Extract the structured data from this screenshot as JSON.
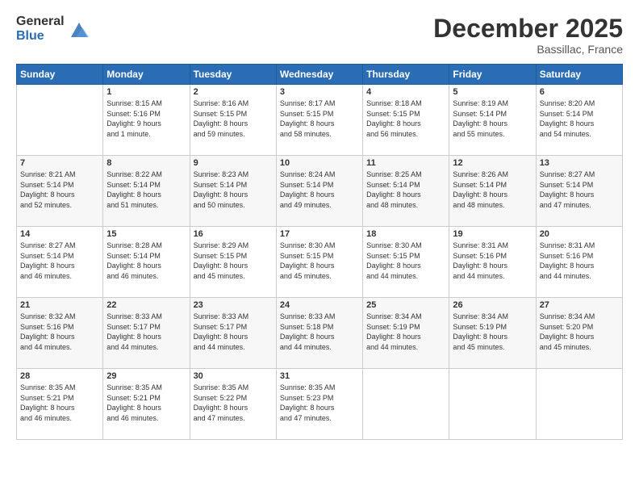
{
  "logo": {
    "general": "General",
    "blue": "Blue"
  },
  "header": {
    "month": "December 2025",
    "location": "Bassillac, France"
  },
  "weekdays": [
    "Sunday",
    "Monday",
    "Tuesday",
    "Wednesday",
    "Thursday",
    "Friday",
    "Saturday"
  ],
  "weeks": [
    [
      {
        "day": "",
        "info": ""
      },
      {
        "day": "1",
        "info": "Sunrise: 8:15 AM\nSunset: 5:16 PM\nDaylight: 9 hours\nand 1 minute."
      },
      {
        "day": "2",
        "info": "Sunrise: 8:16 AM\nSunset: 5:15 PM\nDaylight: 8 hours\nand 59 minutes."
      },
      {
        "day": "3",
        "info": "Sunrise: 8:17 AM\nSunset: 5:15 PM\nDaylight: 8 hours\nand 58 minutes."
      },
      {
        "day": "4",
        "info": "Sunrise: 8:18 AM\nSunset: 5:15 PM\nDaylight: 8 hours\nand 56 minutes."
      },
      {
        "day": "5",
        "info": "Sunrise: 8:19 AM\nSunset: 5:14 PM\nDaylight: 8 hours\nand 55 minutes."
      },
      {
        "day": "6",
        "info": "Sunrise: 8:20 AM\nSunset: 5:14 PM\nDaylight: 8 hours\nand 54 minutes."
      }
    ],
    [
      {
        "day": "7",
        "info": "Sunrise: 8:21 AM\nSunset: 5:14 PM\nDaylight: 8 hours\nand 52 minutes."
      },
      {
        "day": "8",
        "info": "Sunrise: 8:22 AM\nSunset: 5:14 PM\nDaylight: 8 hours\nand 51 minutes."
      },
      {
        "day": "9",
        "info": "Sunrise: 8:23 AM\nSunset: 5:14 PM\nDaylight: 8 hours\nand 50 minutes."
      },
      {
        "day": "10",
        "info": "Sunrise: 8:24 AM\nSunset: 5:14 PM\nDaylight: 8 hours\nand 49 minutes."
      },
      {
        "day": "11",
        "info": "Sunrise: 8:25 AM\nSunset: 5:14 PM\nDaylight: 8 hours\nand 48 minutes."
      },
      {
        "day": "12",
        "info": "Sunrise: 8:26 AM\nSunset: 5:14 PM\nDaylight: 8 hours\nand 48 minutes."
      },
      {
        "day": "13",
        "info": "Sunrise: 8:27 AM\nSunset: 5:14 PM\nDaylight: 8 hours\nand 47 minutes."
      }
    ],
    [
      {
        "day": "14",
        "info": "Sunrise: 8:27 AM\nSunset: 5:14 PM\nDaylight: 8 hours\nand 46 minutes."
      },
      {
        "day": "15",
        "info": "Sunrise: 8:28 AM\nSunset: 5:14 PM\nDaylight: 8 hours\nand 46 minutes."
      },
      {
        "day": "16",
        "info": "Sunrise: 8:29 AM\nSunset: 5:15 PM\nDaylight: 8 hours\nand 45 minutes."
      },
      {
        "day": "17",
        "info": "Sunrise: 8:30 AM\nSunset: 5:15 PM\nDaylight: 8 hours\nand 45 minutes."
      },
      {
        "day": "18",
        "info": "Sunrise: 8:30 AM\nSunset: 5:15 PM\nDaylight: 8 hours\nand 44 minutes."
      },
      {
        "day": "19",
        "info": "Sunrise: 8:31 AM\nSunset: 5:16 PM\nDaylight: 8 hours\nand 44 minutes."
      },
      {
        "day": "20",
        "info": "Sunrise: 8:31 AM\nSunset: 5:16 PM\nDaylight: 8 hours\nand 44 minutes."
      }
    ],
    [
      {
        "day": "21",
        "info": "Sunrise: 8:32 AM\nSunset: 5:16 PM\nDaylight: 8 hours\nand 44 minutes."
      },
      {
        "day": "22",
        "info": "Sunrise: 8:33 AM\nSunset: 5:17 PM\nDaylight: 8 hours\nand 44 minutes."
      },
      {
        "day": "23",
        "info": "Sunrise: 8:33 AM\nSunset: 5:17 PM\nDaylight: 8 hours\nand 44 minutes."
      },
      {
        "day": "24",
        "info": "Sunrise: 8:33 AM\nSunset: 5:18 PM\nDaylight: 8 hours\nand 44 minutes."
      },
      {
        "day": "25",
        "info": "Sunrise: 8:34 AM\nSunset: 5:19 PM\nDaylight: 8 hours\nand 44 minutes."
      },
      {
        "day": "26",
        "info": "Sunrise: 8:34 AM\nSunset: 5:19 PM\nDaylight: 8 hours\nand 45 minutes."
      },
      {
        "day": "27",
        "info": "Sunrise: 8:34 AM\nSunset: 5:20 PM\nDaylight: 8 hours\nand 45 minutes."
      }
    ],
    [
      {
        "day": "28",
        "info": "Sunrise: 8:35 AM\nSunset: 5:21 PM\nDaylight: 8 hours\nand 46 minutes."
      },
      {
        "day": "29",
        "info": "Sunrise: 8:35 AM\nSunset: 5:21 PM\nDaylight: 8 hours\nand 46 minutes."
      },
      {
        "day": "30",
        "info": "Sunrise: 8:35 AM\nSunset: 5:22 PM\nDaylight: 8 hours\nand 47 minutes."
      },
      {
        "day": "31",
        "info": "Sunrise: 8:35 AM\nSunset: 5:23 PM\nDaylight: 8 hours\nand 47 minutes."
      },
      {
        "day": "",
        "info": ""
      },
      {
        "day": "",
        "info": ""
      },
      {
        "day": "",
        "info": ""
      }
    ]
  ]
}
